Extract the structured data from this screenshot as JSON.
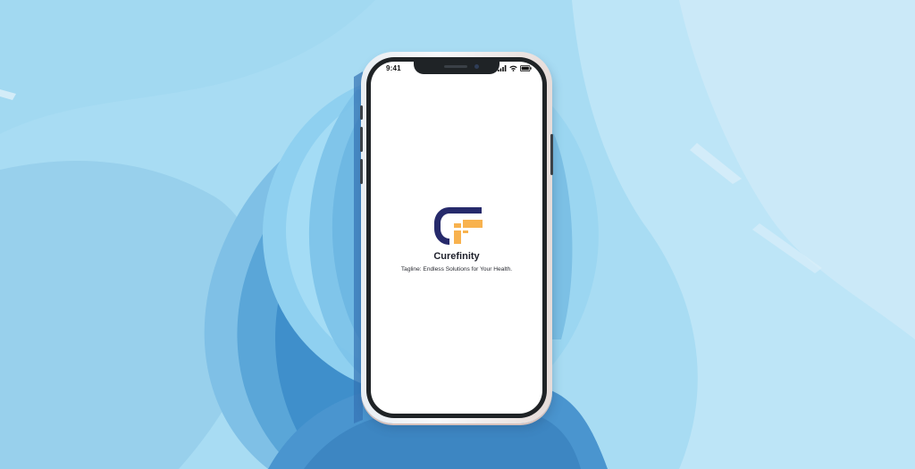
{
  "status_bar": {
    "time": "9:41",
    "icons": [
      "signal-icon",
      "wifi-icon",
      "battery-icon"
    ]
  },
  "app": {
    "logo_icon": "curefinity-logo-icon",
    "name": "Curefinity",
    "tagline": "Tagline: Endless Solutions for Your Health."
  },
  "colors": {
    "background": "#a9dcf3",
    "logo_navy": "#262a6b",
    "logo_orange": "#f8b24e",
    "screen": "#ffffff"
  }
}
